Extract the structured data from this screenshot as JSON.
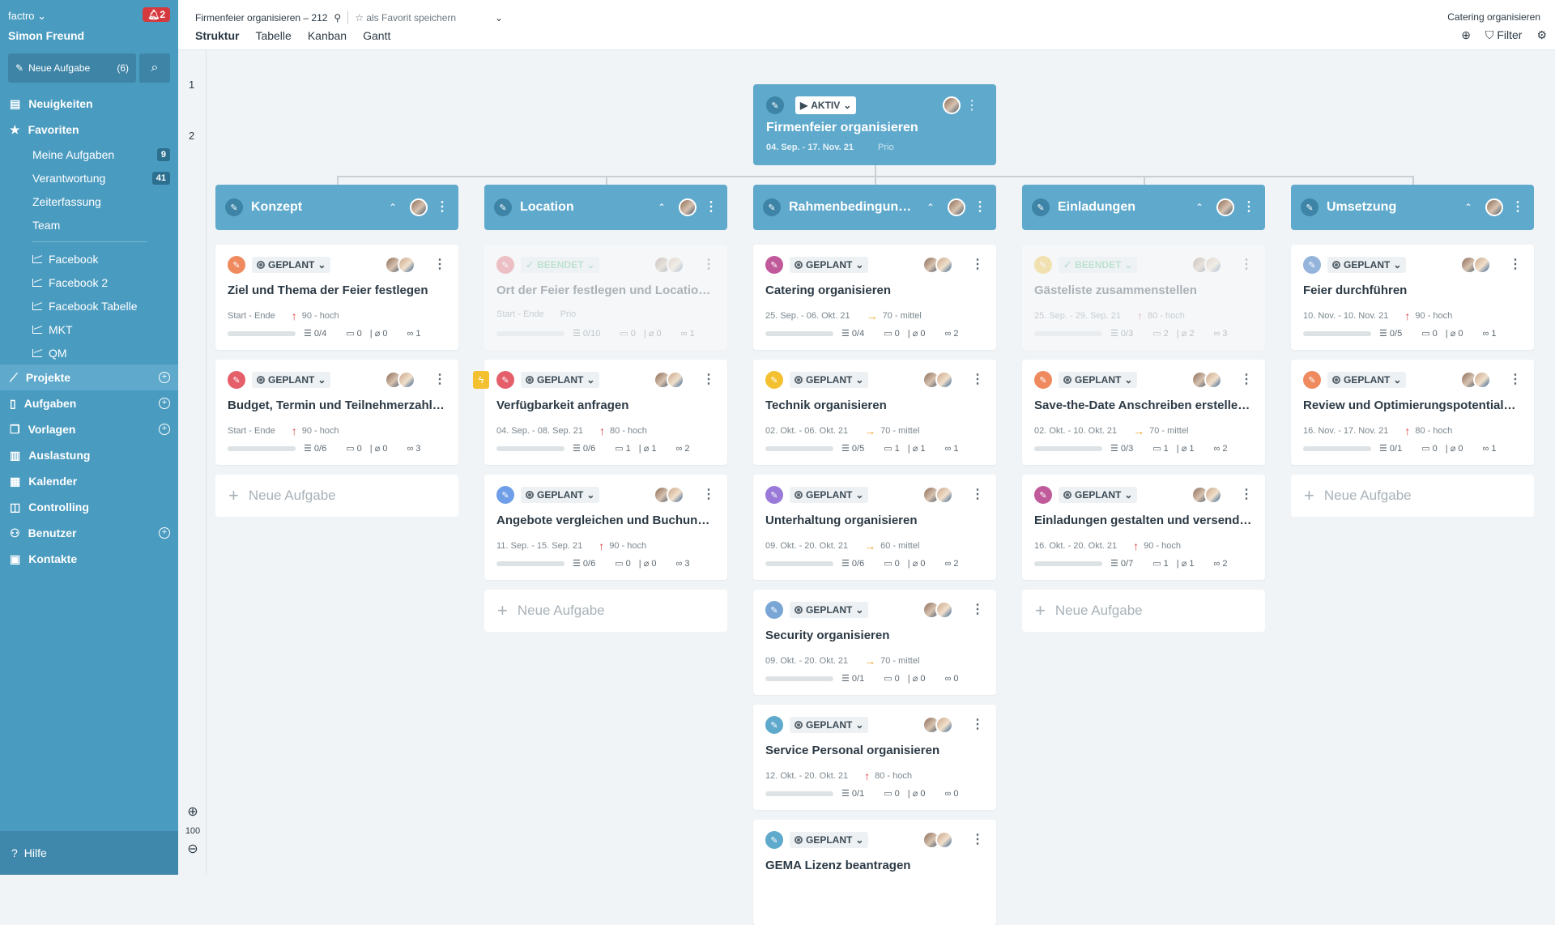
{
  "sidebar": {
    "app": "factro",
    "user": "Simon Freund",
    "notifications": "2",
    "new_task_label": "Neue Aufgabe",
    "new_task_count": "(6)",
    "nav_top": [
      {
        "label": "Neuigkeiten",
        "icon": "news-icon"
      },
      {
        "label": "Favoriten",
        "icon": "star-icon"
      }
    ],
    "fav_items": [
      {
        "label": "Meine Aufgaben",
        "badge": "9"
      },
      {
        "label": "Verantwortung",
        "badge": "41"
      },
      {
        "label": "Zeiterfassung",
        "badge": ""
      },
      {
        "label": "Team",
        "badge": ""
      }
    ],
    "chart_items": [
      "Facebook",
      "Facebook 2",
      "Facebook Tabelle",
      "MKT",
      "QM"
    ],
    "nav_bottom": [
      {
        "label": "Projekte",
        "icon": "chart-line-icon",
        "plus": true,
        "active": true
      },
      {
        "label": "Aufgaben",
        "icon": "document-icon",
        "plus": true
      },
      {
        "label": "Vorlagen",
        "icon": "copy-icon",
        "plus": true
      },
      {
        "label": "Auslastung",
        "icon": "bar-chart-icon",
        "plus": false
      },
      {
        "label": "Kalender",
        "icon": "calendar-icon",
        "plus": false
      },
      {
        "label": "Controlling",
        "icon": "controlling-icon",
        "plus": false
      },
      {
        "label": "Benutzer",
        "icon": "users-icon",
        "plus": true
      },
      {
        "label": "Kontakte",
        "icon": "contacts-icon",
        "plus": false
      }
    ],
    "help": "Hilfe"
  },
  "topbar": {
    "breadcrumb": "Firmenfeier organisieren – 212",
    "favorite": "als Favorit speichern",
    "views": [
      "Struktur",
      "Tabelle",
      "Kanban",
      "Gantt"
    ],
    "active_view": "Struktur",
    "right_title": "Catering organisieren",
    "filter": "Filter"
  },
  "ruler": {
    "levels": [
      "1",
      "2"
    ],
    "zoom": "100"
  },
  "root": {
    "status": "AKTIV",
    "title": "Firmenfeier organisieren",
    "dates": "04. Sep. - 17. Nov. 21",
    "prio": "Prio"
  },
  "new_task_label": "Neue Aufgabe",
  "columns": [
    {
      "title": "Konzept",
      "cards": [
        {
          "status": "GEPLANT",
          "title": "Ziel und Thema der Feier festlegen",
          "dates": "Start - Ende",
          "prio": "90 - hoch",
          "prio_dir": "up",
          "checklist": "0/4",
          "comments": "0",
          "attachments": "0",
          "links": "1",
          "color": "#ef8a5f",
          "faded": false
        },
        {
          "status": "GEPLANT",
          "title": "Budget, Termin und Teilnehmerzahl festlegen",
          "dates": "Start - Ende",
          "prio": "90 - hoch",
          "prio_dir": "up",
          "checklist": "0/6",
          "comments": "0",
          "attachments": "0",
          "links": "3",
          "color": "#e45f6a",
          "faded": false
        }
      ]
    },
    {
      "title": "Location",
      "cards": [
        {
          "status": "BEENDET",
          "title": "Ort der Feier festlegen und Location buchen",
          "dates": "Start - Ende",
          "prio": "Prio",
          "prio_dir": "none",
          "checklist": "0/10",
          "comments": "0",
          "attachments": "0",
          "links": "1",
          "color": "#e45f6a",
          "faded": true
        },
        {
          "status": "GEPLANT",
          "title": "Verfügbarkeit anfragen",
          "dates": "04. Sep. - 08. Sep. 21",
          "prio": "80 - hoch",
          "prio_dir": "up",
          "checklist": "0/6",
          "comments": "1",
          "attachments": "1",
          "links": "2",
          "color": "#e45f6a",
          "faded": false,
          "flag": true
        },
        {
          "status": "GEPLANT",
          "title": "Angebote vergleichen und Buchung vornehmen",
          "dates": "11. Sep. - 15. Sep. 21",
          "prio": "90 - hoch",
          "prio_dir": "up",
          "checklist": "0/6",
          "comments": "0",
          "attachments": "0",
          "links": "3",
          "color": "#6f9ee8",
          "faded": false
        }
      ]
    },
    {
      "title": "Rahmenbedingungen",
      "cards": [
        {
          "status": "GEPLANT",
          "title": "Catering organisieren",
          "dates": "25. Sep. - 06. Okt. 21",
          "prio": "70 - mittel",
          "prio_dir": "right",
          "checklist": "0/4",
          "comments": "0",
          "attachments": "0",
          "links": "2",
          "color": "#c05a9a",
          "faded": false
        },
        {
          "status": "GEPLANT",
          "title": "Technik organisieren",
          "dates": "02. Okt. - 06. Okt. 21",
          "prio": "70 - mittel",
          "prio_dir": "right",
          "checklist": "0/5",
          "comments": "1",
          "attachments": "1",
          "links": "1",
          "color": "#f3c030",
          "faded": false
        },
        {
          "status": "GEPLANT",
          "title": "Unterhaltung organisieren",
          "dates": "09. Okt. - 20. Okt. 21",
          "prio": "60 - mittel",
          "prio_dir": "right",
          "checklist": "0/6",
          "comments": "0",
          "attachments": "0",
          "links": "2",
          "color": "#9a7ad8",
          "faded": false
        },
        {
          "status": "GEPLANT",
          "title": "Security organisieren",
          "dates": "09. Okt. - 20. Okt. 21",
          "prio": "70 - mittel",
          "prio_dir": "right",
          "checklist": "0/1",
          "comments": "0",
          "attachments": "0",
          "links": "0",
          "color": "#7aa6d6",
          "faded": false
        },
        {
          "status": "GEPLANT",
          "title": "Service Personal organisieren",
          "dates": "12. Okt. - 20. Okt. 21",
          "prio": "80 - hoch",
          "prio_dir": "up",
          "checklist": "0/1",
          "comments": "0",
          "attachments": "0",
          "links": "0",
          "color": "#5ea9cc",
          "faded": false
        },
        {
          "status": "GEPLANT",
          "title": "GEMA Lizenz beantragen",
          "dates": "",
          "prio": "",
          "prio_dir": "none",
          "checklist": "",
          "comments": "",
          "attachments": "",
          "links": "",
          "color": "#5ea9cc",
          "faded": false
        }
      ]
    },
    {
      "title": "Einladungen",
      "cards": [
        {
          "status": "BEENDET",
          "title": "Gästeliste zusammenstellen",
          "dates": "25. Sep. - 29. Sep. 21",
          "prio": "80 - hoch",
          "prio_dir": "up",
          "checklist": "0/3",
          "comments": "2",
          "attachments": "2",
          "links": "3",
          "color": "#f3c030",
          "faded": true
        },
        {
          "status": "GEPLANT",
          "title": "Save-the-Date Anschreiben erstellen und versenden",
          "dates": "02. Okt. - 10. Okt. 21",
          "prio": "70 - mittel",
          "prio_dir": "right",
          "checklist": "0/3",
          "comments": "1",
          "attachments": "1",
          "links": "2",
          "color": "#ef8a5f",
          "faded": false
        },
        {
          "status": "GEPLANT",
          "title": "Einladungen gestalten und versenden",
          "dates": "16. Okt. - 20. Okt. 21",
          "prio": "90 - hoch",
          "prio_dir": "up",
          "checklist": "0/7",
          "comments": "1",
          "attachments": "1",
          "links": "2",
          "color": "#c05a9a",
          "faded": false
        }
      ]
    },
    {
      "title": "Umsetzung",
      "cards": [
        {
          "status": "GEPLANT",
          "title": "Feier durchführen",
          "dates": "10. Nov. - 10. Nov. 21",
          "prio": "90 - hoch",
          "prio_dir": "up",
          "checklist": "0/5",
          "comments": "0",
          "attachments": "0",
          "links": "1",
          "color": "#94b4dc",
          "faded": false
        },
        {
          "status": "GEPLANT",
          "title": "Review und Optimierungspotentiale festhalten",
          "dates": "16. Nov. - 17. Nov. 21",
          "prio": "80 - hoch",
          "prio_dir": "up",
          "checklist": "0/1",
          "comments": "0",
          "attachments": "0",
          "links": "1",
          "color": "#ef8a5f",
          "faded": false
        }
      ]
    }
  ],
  "colors": {
    "accent": "#5ea9cc",
    "sidebar": "#4a9bc0",
    "prio_high": "#d6393d",
    "prio_mid": "#f0a020",
    "notification": "#d6393d"
  }
}
